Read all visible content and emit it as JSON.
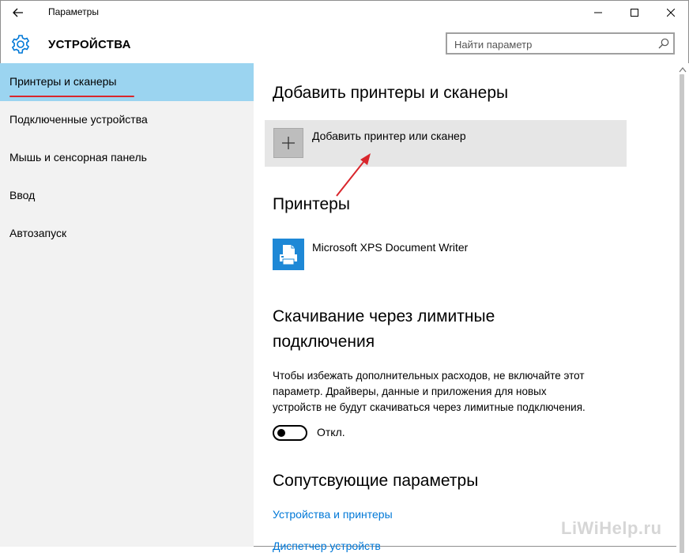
{
  "window": {
    "title": "Параметры"
  },
  "header": {
    "section_title": "УСТРОЙСТВА",
    "search_placeholder": "Найти параметр"
  },
  "sidebar": {
    "items": [
      {
        "label": "Принтеры и сканеры",
        "active": true
      },
      {
        "label": "Подключенные устройства"
      },
      {
        "label": "Мышь и сенсорная панель"
      },
      {
        "label": "Ввод"
      },
      {
        "label": "Автозапуск"
      }
    ]
  },
  "content": {
    "add_section_title": "Добавить принтеры и сканеры",
    "add_button_label": "Добавить принтер или сканер",
    "printers_title": "Принтеры",
    "printers": [
      {
        "name": "Microsoft XPS Document Writer",
        "icon": "printer-icon"
      }
    ],
    "metered_title_line1": "Скачивание через лимитные",
    "metered_title_line2": "подключения",
    "metered_desc_line1": "Чтобы избежать дополнительных расходов, не включайте этот",
    "metered_desc_line2": "параметр. Драйверы, данные и приложения для новых",
    "metered_desc_line3": "устройств не будут скачиваться через лимитные подключения.",
    "toggle_label": "Откл.",
    "toggle_on": false,
    "related_title": "Сопутсвующие параметры",
    "links": [
      "Устройства и принтеры",
      "Диспетчер устройств"
    ]
  },
  "watermark": "LiWiHelp.ru",
  "colors": {
    "accent": "#0078d7",
    "sidebar_active": "#9bd4f0",
    "sidebar_bg": "#f2f2f2",
    "annotation": "#d9262c",
    "printer_icon": "#1e88d6"
  }
}
